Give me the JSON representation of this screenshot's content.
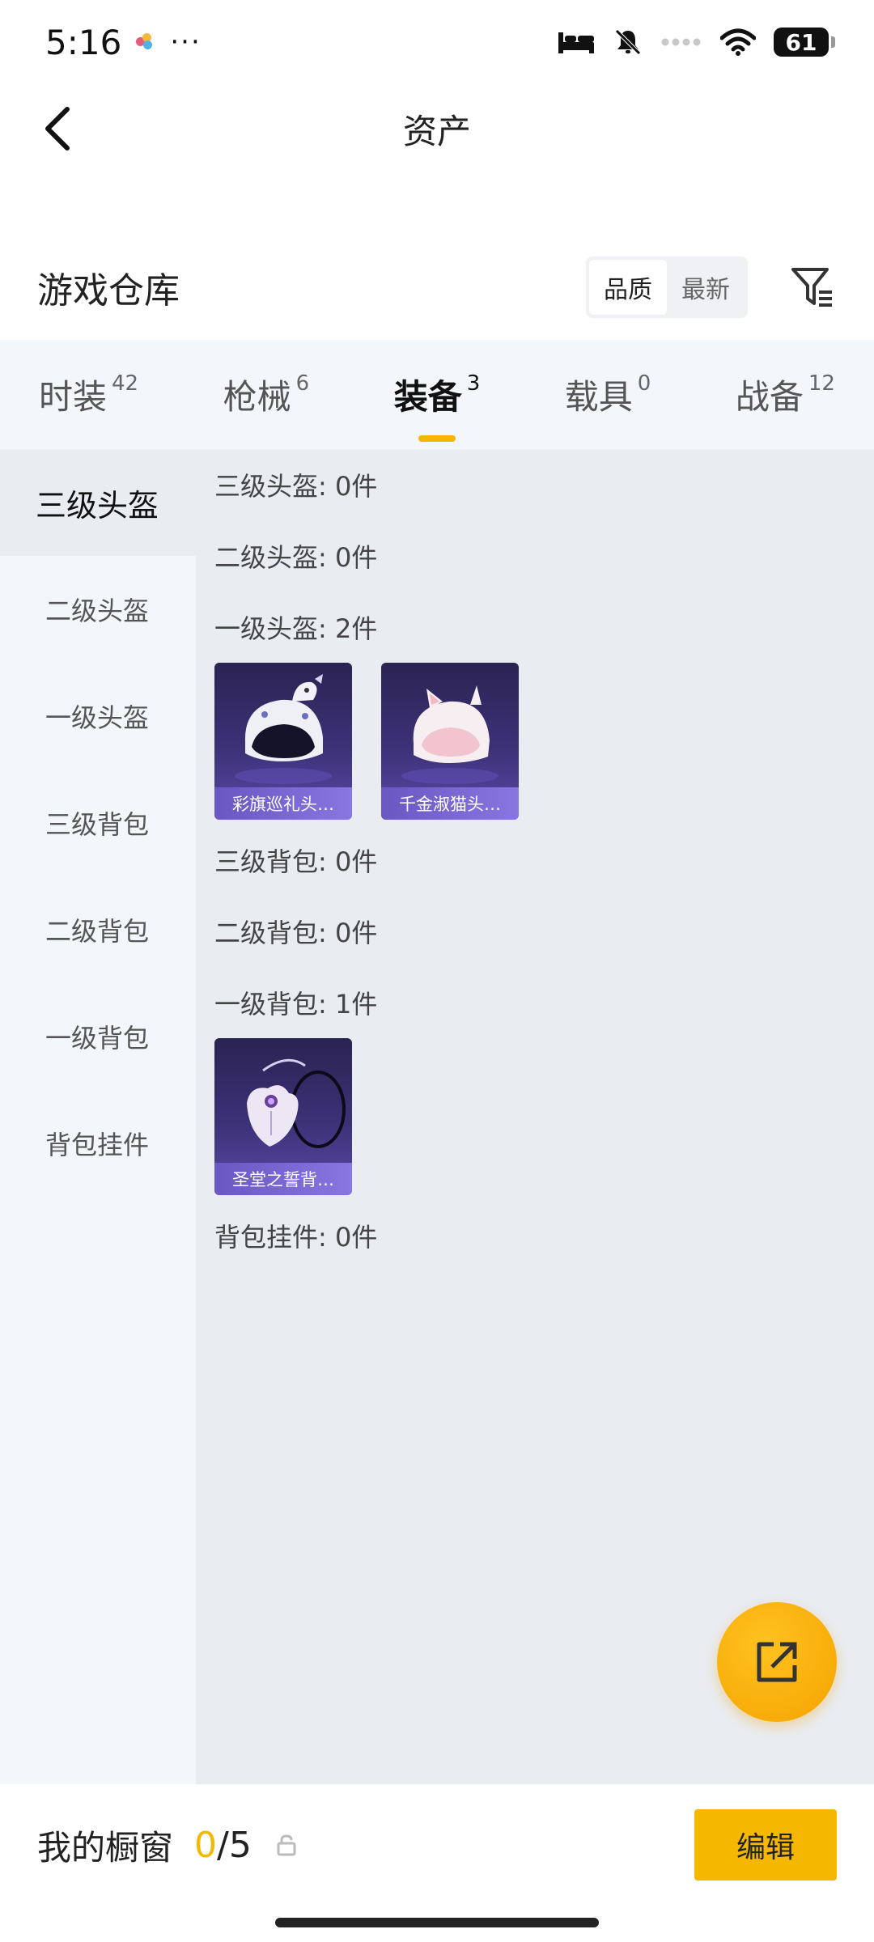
{
  "status_bar": {
    "time": "5:16",
    "dots": "···",
    "battery": "61"
  },
  "header": {
    "title": "资产"
  },
  "warehouse": {
    "title": "游戏仓库",
    "sort_options": [
      "品质",
      "最新"
    ],
    "active_sort": "品质"
  },
  "tabs": [
    {
      "label": "时装",
      "count": "42"
    },
    {
      "label": "枪械",
      "count": "6"
    },
    {
      "label": "装备",
      "count": "3"
    },
    {
      "label": "载具",
      "count": "0"
    },
    {
      "label": "战备",
      "count": "12"
    }
  ],
  "sidebar": {
    "items": [
      "三级头盔",
      "二级头盔",
      "一级头盔",
      "三级背包",
      "二级背包",
      "一级背包",
      "背包挂件"
    ]
  },
  "sections": [
    {
      "label": "三级头盔: 0件",
      "items": []
    },
    {
      "label": "二级头盔: 0件",
      "items": []
    },
    {
      "label": "一级头盔: 2件",
      "items": [
        {
          "name": "彩旗巡礼头…",
          "icon": "helmet-icon"
        },
        {
          "name": "千金淑猫头…",
          "icon": "cat-helmet-icon"
        }
      ]
    },
    {
      "label": "三级背包: 0件",
      "items": []
    },
    {
      "label": "二级背包: 0件",
      "items": []
    },
    {
      "label": "一级背包: 1件",
      "items": [
        {
          "name": "圣堂之誓背…",
          "icon": "backpack-icon"
        }
      ]
    },
    {
      "label": "背包挂件: 0件",
      "items": []
    }
  ],
  "showcase": {
    "label": "我的橱窗",
    "used": "0",
    "total": "/5",
    "edit_label": "编辑"
  },
  "colors": {
    "accent": "#f6b700",
    "card_bg": "#3d3178"
  }
}
